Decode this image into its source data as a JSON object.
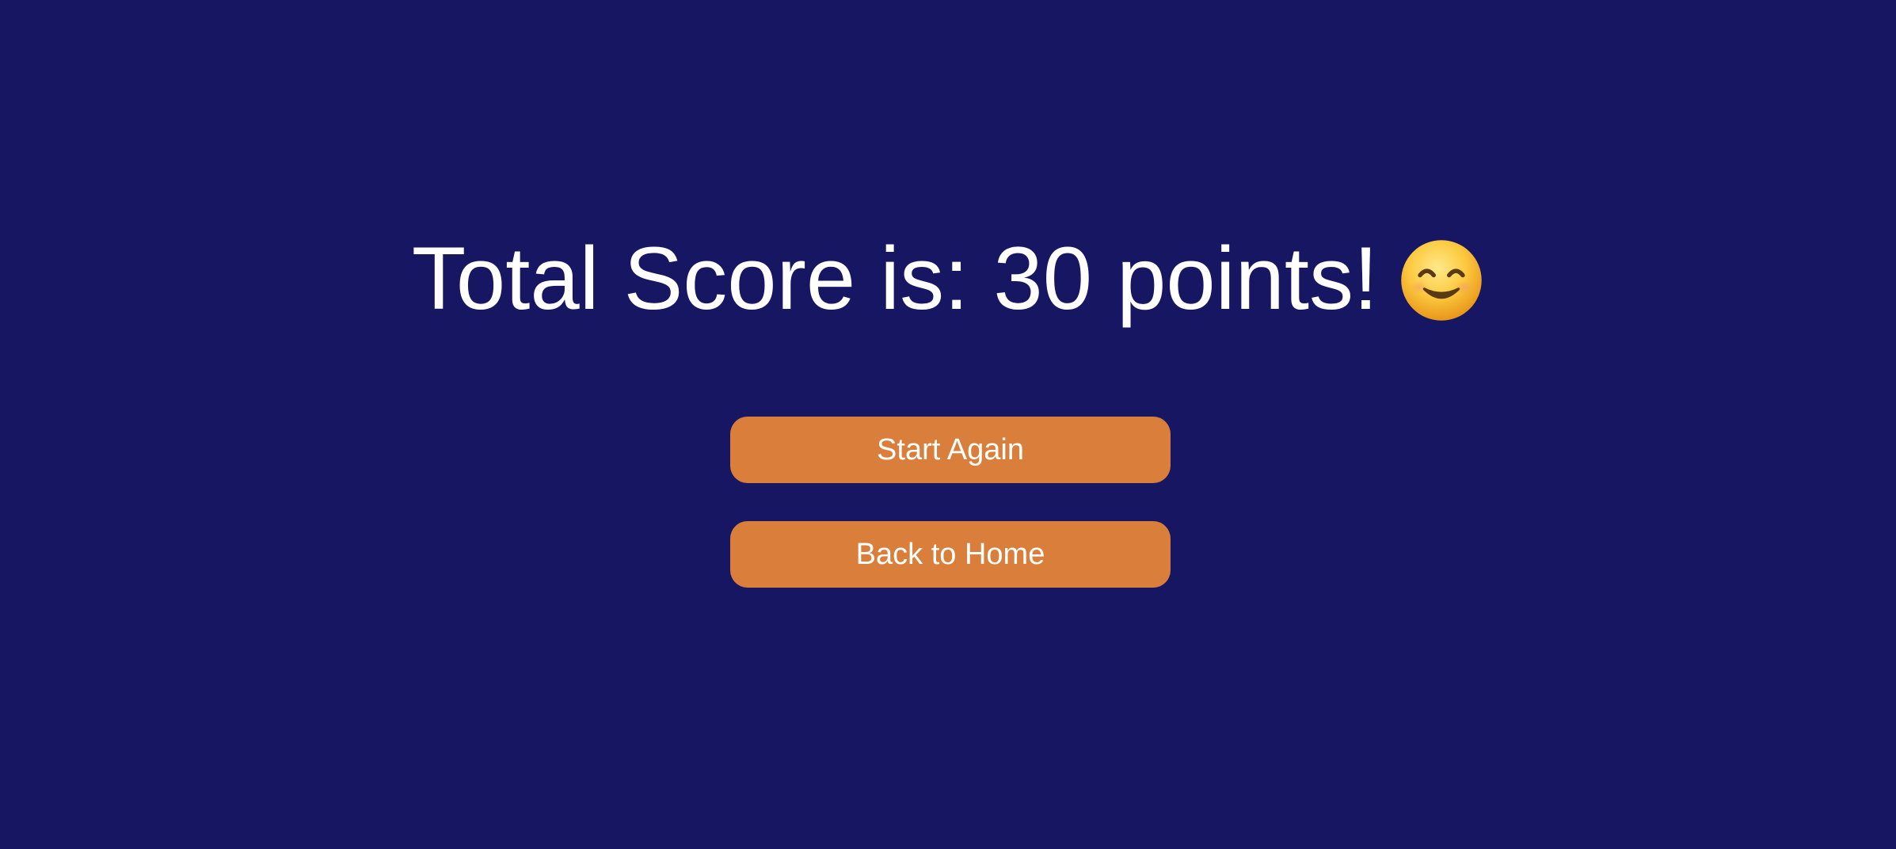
{
  "result": {
    "score_text": "Total Score is: 30 points!",
    "emoji_icon": "smiling-face-with-smiling-eyes"
  },
  "actions": {
    "start_again_label": "Start Again",
    "back_home_label": "Back to Home"
  },
  "colors": {
    "background": "#171663",
    "button": "#d97f3b",
    "text": "#ffffff"
  }
}
